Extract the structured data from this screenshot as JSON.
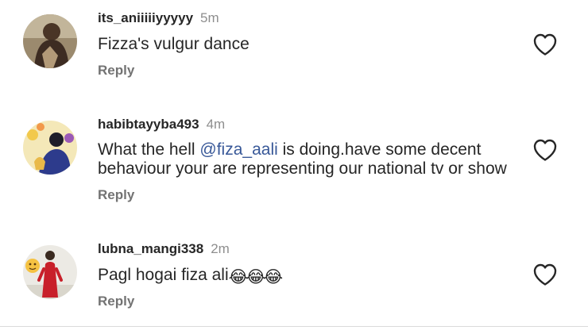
{
  "comments": [
    {
      "username": "its_aniiiiiyyyyy",
      "time": "5m",
      "text": "Fizza's vulgur dance",
      "reply_label": "Reply",
      "avatar_icon": "user-avatar-photo",
      "like_icon": "heart-outline-icon"
    },
    {
      "username": "habibtayyba493",
      "time": "4m",
      "text_before": "What the hell ",
      "mention": "@fiza_aali",
      "text_after": " is doing.have some decent behaviour your are representing our national tv or show",
      "reply_label": "Reply",
      "avatar_icon": "user-avatar-photo",
      "like_icon": "heart-outline-icon"
    },
    {
      "username": "lubna_mangi338",
      "time": "2m",
      "text": "Pagl hogai fiza ali",
      "emojis": [
        "😂",
        "😂",
        "😂"
      ],
      "reply_label": "Reply",
      "avatar_icon": "user-avatar-photo",
      "like_icon": "heart-outline-icon"
    }
  ],
  "colors": {
    "text": "#262626",
    "secondary": "#8e8e8e",
    "reply": "#737373",
    "mention": "#385898",
    "divider": "#dbdbdb"
  }
}
